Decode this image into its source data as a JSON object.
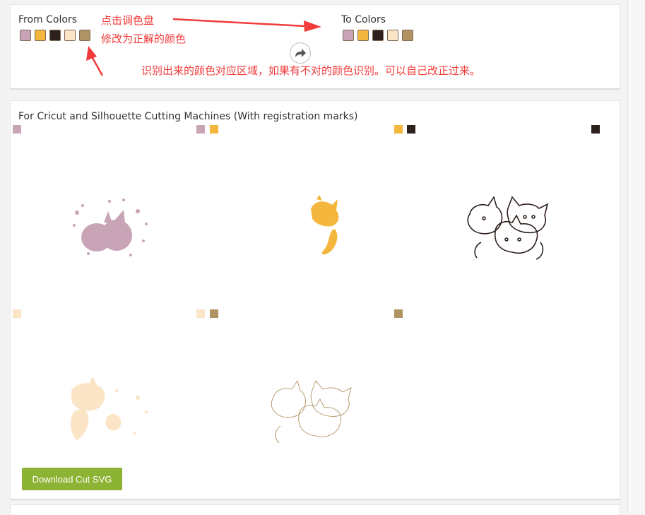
{
  "top_panel": {
    "from_label": "From Colors",
    "to_label": "To Colors",
    "from_colors": [
      "#c9a3b6",
      "#f4b63c",
      "#2e201c",
      "#fbe5c6",
      "#b09263"
    ],
    "to_colors": [
      "#c9a3b6",
      "#f4b63c",
      "#2e201c",
      "#fbe5c6",
      "#b09263"
    ],
    "swap_icon": "swap-arrow-icon"
  },
  "annotations": {
    "palette_line1": "点击调色盘",
    "palette_line2": "修改为正解的颜色",
    "region_note": "识别出来的颜色对应区域，如果有不对的颜色识别。可以自己改正过来。",
    "arrow_color": "#f23b3b"
  },
  "cut_panel": {
    "title": "For Cricut and Silhouette Cutting Machines (With registration marks)",
    "layers": [
      {
        "marks": [
          "#c9a3b6"
        ],
        "art_color": "#c9a3b6",
        "art_icon": "kittens-pink-layer-icon"
      },
      {
        "marks": [
          "#c9a3b6",
          "#f4b63c"
        ],
        "art_color": "#f4b63c",
        "art_icon": "kittens-orange-layer-icon"
      },
      {
        "marks": [
          "#f4b63c",
          "#2e201c"
        ],
        "art_color": "#2e201c",
        "art_icon": "kittens-outline-layer-icon"
      },
      {
        "marks": [
          "#2e201c"
        ],
        "art_color": "",
        "art_icon": ""
      },
      {
        "marks": [
          "#fbe5c6"
        ],
        "art_color": "#fbe5c6",
        "art_icon": "kittens-cream-layer-icon"
      },
      {
        "marks": [
          "#fbe5c6",
          "#b09263"
        ],
        "art_color": "#b09263",
        "art_icon": "kittens-tan-layer-icon"
      },
      {
        "marks": [
          "#b09263"
        ],
        "art_color": "",
        "art_icon": ""
      }
    ],
    "download_label": "Download Cut SVG"
  }
}
